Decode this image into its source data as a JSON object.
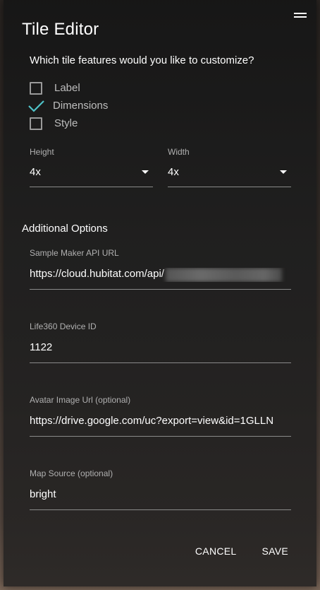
{
  "dialog": {
    "title": "Tile Editor",
    "question": "Which tile features would you like to customize?",
    "features": [
      {
        "label": "Label",
        "checked": false
      },
      {
        "label": "Dimensions",
        "checked": true
      },
      {
        "label": "Style",
        "checked": false
      }
    ],
    "height": {
      "label": "Height",
      "value": "4x"
    },
    "width": {
      "label": "Width",
      "value": "4x"
    },
    "section_title": "Additional Options",
    "fields": {
      "maker_api": {
        "label": "Sample Maker API URL",
        "value": "https://cloud.hubitat.com/api/"
      },
      "device_id": {
        "label": "Life360 Device ID",
        "value": "1122"
      },
      "avatar": {
        "label": "Avatar Image Url (optional)",
        "value": "https://drive.google.com/uc?export=view&id=1GLLN"
      },
      "map_source": {
        "label": "Map Source (optional)",
        "value": "bright"
      }
    },
    "buttons": {
      "cancel": "CANCEL",
      "save": "SAVE"
    }
  },
  "colors": {
    "accent_check": "#4fc3c8"
  },
  "icons": {
    "menu": "menu-icon",
    "check": "check-icon",
    "dropdown": "chevron-down-icon"
  }
}
